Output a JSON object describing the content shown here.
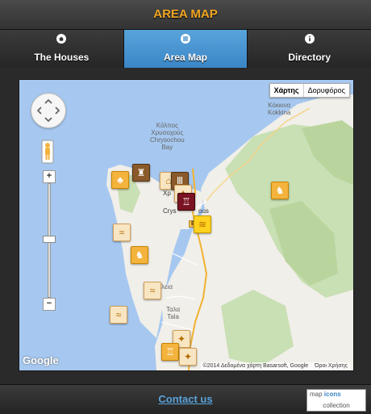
{
  "header": {
    "title": "AREA MAP"
  },
  "tabs": [
    {
      "label": "The Houses",
      "icon": "home-icon",
      "active": false
    },
    {
      "label": "Area Map",
      "icon": "grid-icon",
      "active": true
    },
    {
      "label": "Directory",
      "icon": "info-icon",
      "active": false
    }
  ],
  "map": {
    "map_type": {
      "map": "Χάρτης",
      "satellite": "Δορυφόρος"
    },
    "zoom_in": "+",
    "zoom_out": "−",
    "places": {
      "kokkina_gr": "Κόκκινα",
      "kokkina_en": "Kokkina",
      "bay_gr1": "Κόλπος",
      "bay_gr2": "Χρυσοχούς",
      "bay_en1": "Chrysochou",
      "bay_en2": "Bay",
      "polis_gr": "Χρ",
      "polis_en": "Crys",
      "polis_en_suffix": "ous",
      "neo_chorio": "λεια",
      "tala_gr": "Ταλα",
      "tala_en": "Tala"
    },
    "road_shield": "B7",
    "logo": "Google",
    "attribution": "©2014 Δεδομένα χάρτη Basarsoft, Google",
    "terms": "Όροι Χρήσης",
    "markers": [
      {
        "type": "forest",
        "icon": "tree-icon"
      },
      {
        "type": "monument",
        "icon": "statue-icon"
      },
      {
        "type": "lodging",
        "icon": "house-icon"
      },
      {
        "type": "museum",
        "icon": "temple-icon"
      },
      {
        "type": "attraction",
        "icon": "compass-icon"
      },
      {
        "type": "castle",
        "icon": "castle-icon"
      },
      {
        "type": "beach",
        "icon": "waves-icon"
      },
      {
        "type": "wildlife",
        "icon": "deer-icon"
      },
      {
        "type": "beach",
        "icon": "swim-icon"
      },
      {
        "type": "wildlife",
        "icon": "deer-icon"
      },
      {
        "type": "beach",
        "icon": "swim-icon"
      },
      {
        "type": "beach",
        "icon": "swim-icon"
      },
      {
        "type": "attraction",
        "icon": "compass-icon"
      },
      {
        "type": "castle",
        "icon": "castle-icon"
      },
      {
        "type": "attraction",
        "icon": "compass-icon"
      }
    ]
  },
  "footer": {
    "contact_label": "Contact us",
    "badge_top_prefix": "map",
    "badge_top_highlight": "icons",
    "badge_bottom": "collection"
  },
  "colors": {
    "accent": "#f2a623",
    "tab_active": "#3a86c6",
    "link": "#5aa4dc"
  }
}
